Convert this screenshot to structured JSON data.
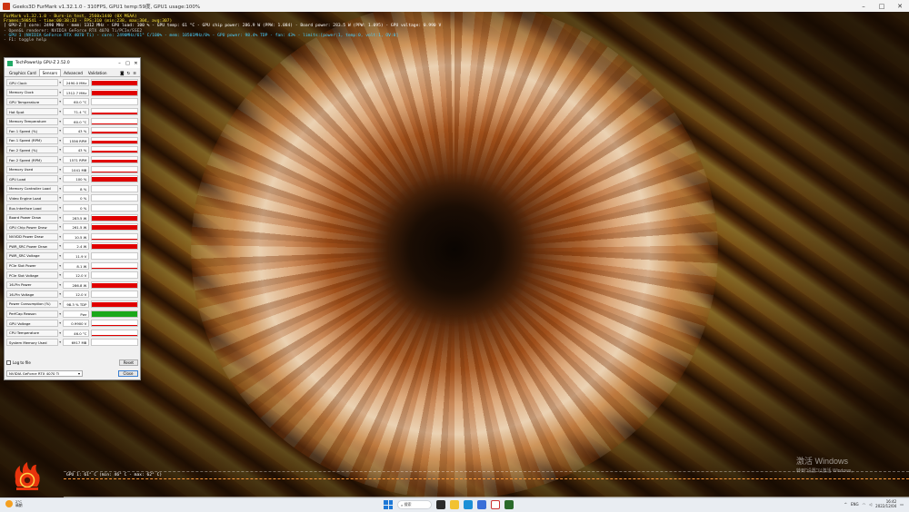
{
  "furmark": {
    "window_title": "Geeks3D FurMark v1.32.1.0 - 310FPS, GPU1 temp:59度, GPU1 usage:100%",
    "osd": {
      "line1": "FurMark v1.32.1.0 - Burn-in test, 2560x1440 (0X MSAA)",
      "line2": "Frames:598541 - time:00:38:33 - FPS:310 (min:238, max:304, avg:307)",
      "line3": "[ GPU-Z ] core: 2490 MHz - mem: 1312 MHz - GPU load: 100 % - GPU temp: 61 °C - GPU chip power: 286.9 W (PPW: 1.084) - Board power: 283.5 W (PPW: 1.095) - GPU voltage: 0.990 V",
      "line4": "- OpenGL renderer: NVIDIA GeForce RTX 4070 Ti/PCIe/SSE2",
      "line5": "- GPU 1 (NVIDIA GeForce RTX 4070 Ti) - core: 2490MHz/61° C/100% - mem: 10501MHz/8% - GPU power: 98.4% TDP - fan: 43% - limits:[power:1, temp:0, volt:1, OV:0]",
      "line6": "- F1: toggle help"
    },
    "graph_caption": "GPU 1: 61° C (min: 46° C - max: 62° C)"
  },
  "gpuz": {
    "title": "TechPowerUp GPU-Z 2.52.0",
    "tabs": [
      {
        "label": "Graphics Card",
        "active": false
      },
      {
        "label": "Sensors",
        "active": true
      },
      {
        "label": "Advanced",
        "active": false
      },
      {
        "label": "Validation",
        "active": false
      }
    ],
    "sensors": [
      {
        "label": "GPU Clock",
        "value": "2490.0 MHz",
        "level": 0.85,
        "color": "#e00000"
      },
      {
        "label": "Memory Clock",
        "value": "1312.7 MHz",
        "level": 0.85,
        "color": "#e00000"
      },
      {
        "label": "GPU Temperature",
        "value": "60.0 °C",
        "level": 0.12,
        "color": "#e00000"
      },
      {
        "label": "Hot Spot",
        "value": "71.4 °C",
        "level": 0.3,
        "color": "#e00000"
      },
      {
        "label": "Memory Temperature",
        "value": "60.0 °C",
        "level": 0.15,
        "color": "#e00000"
      },
      {
        "label": "Fan 1 Speed (%)",
        "value": "43 %",
        "level": 0.45,
        "color": "#e00000"
      },
      {
        "label": "Fan 1 Speed (RPM)",
        "value": "1556 RPM",
        "level": 0.45,
        "color": "#e00000"
      },
      {
        "label": "Fan 2 Speed (%)",
        "value": "43 %",
        "level": 0.45,
        "color": "#e00000"
      },
      {
        "label": "Fan 2 Speed (RPM)",
        "value": "1571 RPM",
        "level": 0.45,
        "color": "#e00000"
      },
      {
        "label": "Memory Used",
        "value": "1041 MB",
        "level": 0.12,
        "color": "#e00000"
      },
      {
        "label": "GPU Load",
        "value": "100 %",
        "level": 0.85,
        "color": "#e00000"
      },
      {
        "label": "Memory Controller Load",
        "value": "8 %",
        "level": 0.04,
        "color": "#e00000"
      },
      {
        "label": "Video Engine Load",
        "value": "0 %",
        "level": 0,
        "color": "#e00000"
      },
      {
        "label": "Bus Interface Load",
        "value": "0 %",
        "level": 0,
        "color": "#e00000"
      },
      {
        "label": "Board Power Draw",
        "value": "283.5 W",
        "level": 0.85,
        "color": "#e00000"
      },
      {
        "label": "GPU Chip Power Draw",
        "value": "261.5 W",
        "level": 0.85,
        "color": "#e00000"
      },
      {
        "label": "NVVDD Power Draw",
        "value": "10.5 W",
        "level": 0.08,
        "color": "#e00000"
      },
      {
        "label": "PWR_SRC Power Draw",
        "value": "2.4 W",
        "level": 0.85,
        "color": "#e00000"
      },
      {
        "label": "PWR_SRC Voltage",
        "value": "11.9 V",
        "level": 0.08,
        "color": "#e00000"
      },
      {
        "label": "PCIe Slot Power",
        "value": "8.1 W",
        "level": 0.1,
        "color": "#e00000"
      },
      {
        "label": "PCIe Slot Voltage",
        "value": "12.0 V",
        "level": 0.1,
        "color": "#e00000"
      },
      {
        "label": "16-Pin Power",
        "value": "286.8 W",
        "level": 0.85,
        "color": "#e00000"
      },
      {
        "label": "16-Pin Voltage",
        "value": "12.0 V",
        "level": 0.1,
        "color": "#e00000"
      },
      {
        "label": "Power Consumption (%)",
        "value": "98.3 % TDP",
        "level": 0.85,
        "color": "#e00000"
      },
      {
        "label": "PerfCap Reason",
        "value": "Pwr",
        "level": 0.85,
        "color": "#1aa81a"
      },
      {
        "label": "GPU Voltage",
        "value": "0.9900 V",
        "level": 0.12,
        "color": "#e00000"
      },
      {
        "label": "CPU Temperature",
        "value": "46.0 °C",
        "level": 0.12,
        "color": "#e00000"
      },
      {
        "label": "System Memory Used",
        "value": "6917 MB",
        "level": 0.12,
        "color": "#e00000"
      }
    ],
    "log_label": "Log to file",
    "reset_label": "Reset",
    "device": "NVIDIA GeForce RTX 4070 Ti",
    "close_label": "Close"
  },
  "watermark": {
    "line1": "激活 Windows",
    "line2": "转到\"设置\"以激活 Windows。"
  },
  "taskbar": {
    "weather_temp": "2°C",
    "weather_desc": "晴朗",
    "search_placeholder": "搜索",
    "lang": "ENG",
    "time": "16:42",
    "date": "2022/12/04"
  },
  "colors": {
    "accent": "#1e78d6",
    "graph_red": "#e00000",
    "graph_green": "#1aa81a",
    "osd_yellow": "#ffe93a",
    "osd_cyan": "#4ad0ff"
  }
}
